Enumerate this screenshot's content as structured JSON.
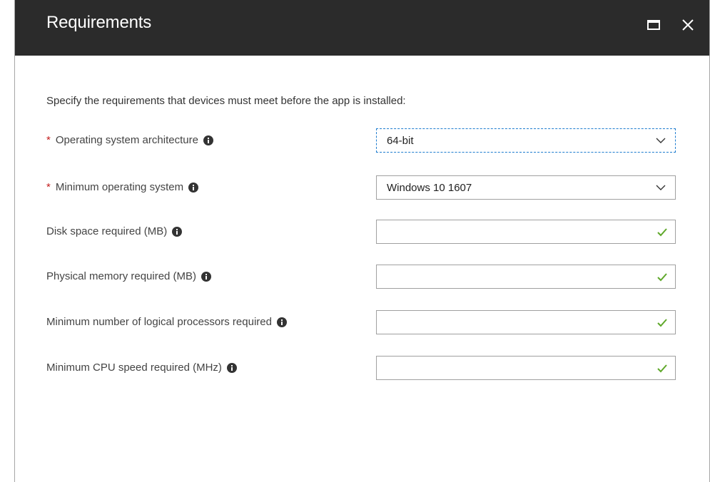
{
  "dialog": {
    "title": "Requirements",
    "intro": "Specify the requirements that devices must meet before the app is installed:",
    "required_marker": "*"
  },
  "fields": {
    "os_architecture": {
      "label": "Operating system architecture",
      "value": "64-bit"
    },
    "min_os": {
      "label": "Minimum operating system",
      "value": "Windows 10 1607"
    },
    "disk_space": {
      "label": "Disk space required (MB)",
      "value": ""
    },
    "physical_memory": {
      "label": "Physical memory required (MB)",
      "value": ""
    },
    "logical_processors": {
      "label": "Minimum number of logical processors required",
      "value": ""
    },
    "cpu_speed": {
      "label": "Minimum CPU speed required (MHz)",
      "value": ""
    }
  },
  "icons": {
    "info": "info-icon",
    "dropdown": "chevron-down-icon",
    "valid": "checkmark-icon",
    "maximize": "maximize-icon",
    "close": "close-icon"
  },
  "colors": {
    "header_bg": "#2b2b2b",
    "required": "#c41e1e",
    "valid_check": "#5fa82a",
    "focus_border": "#1d7ccf"
  }
}
